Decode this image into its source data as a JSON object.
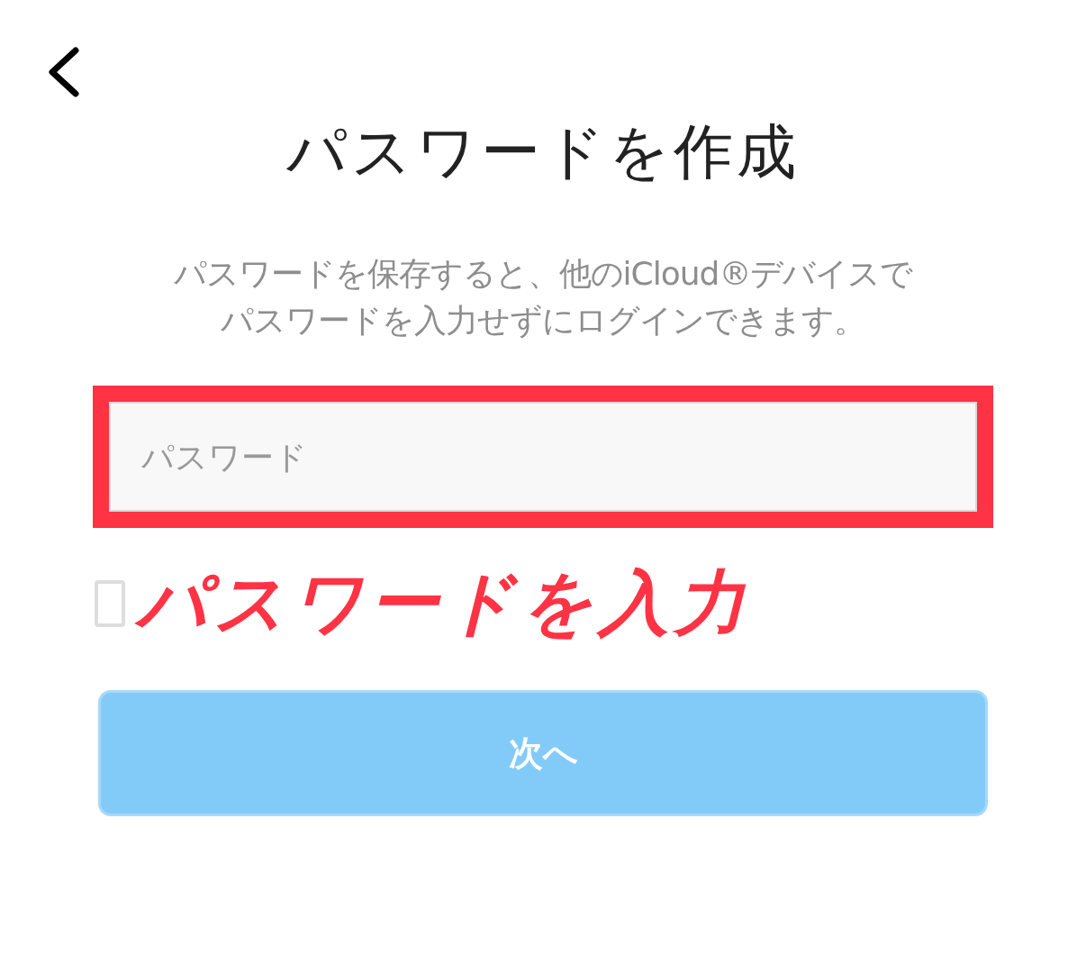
{
  "title": "パスワードを作成",
  "description_lines": [
    "パスワードを保存すると、他のiCloud®デバイスで",
    "パスワードを入力せずにログインできます。"
  ],
  "password_field": {
    "placeholder": "パスワード",
    "highlighted": true
  },
  "save_checkbox": {
    "checked": false
  },
  "annotation": "パスワードを入力",
  "next_button": {
    "label": "次へ",
    "disabled": true
  }
}
